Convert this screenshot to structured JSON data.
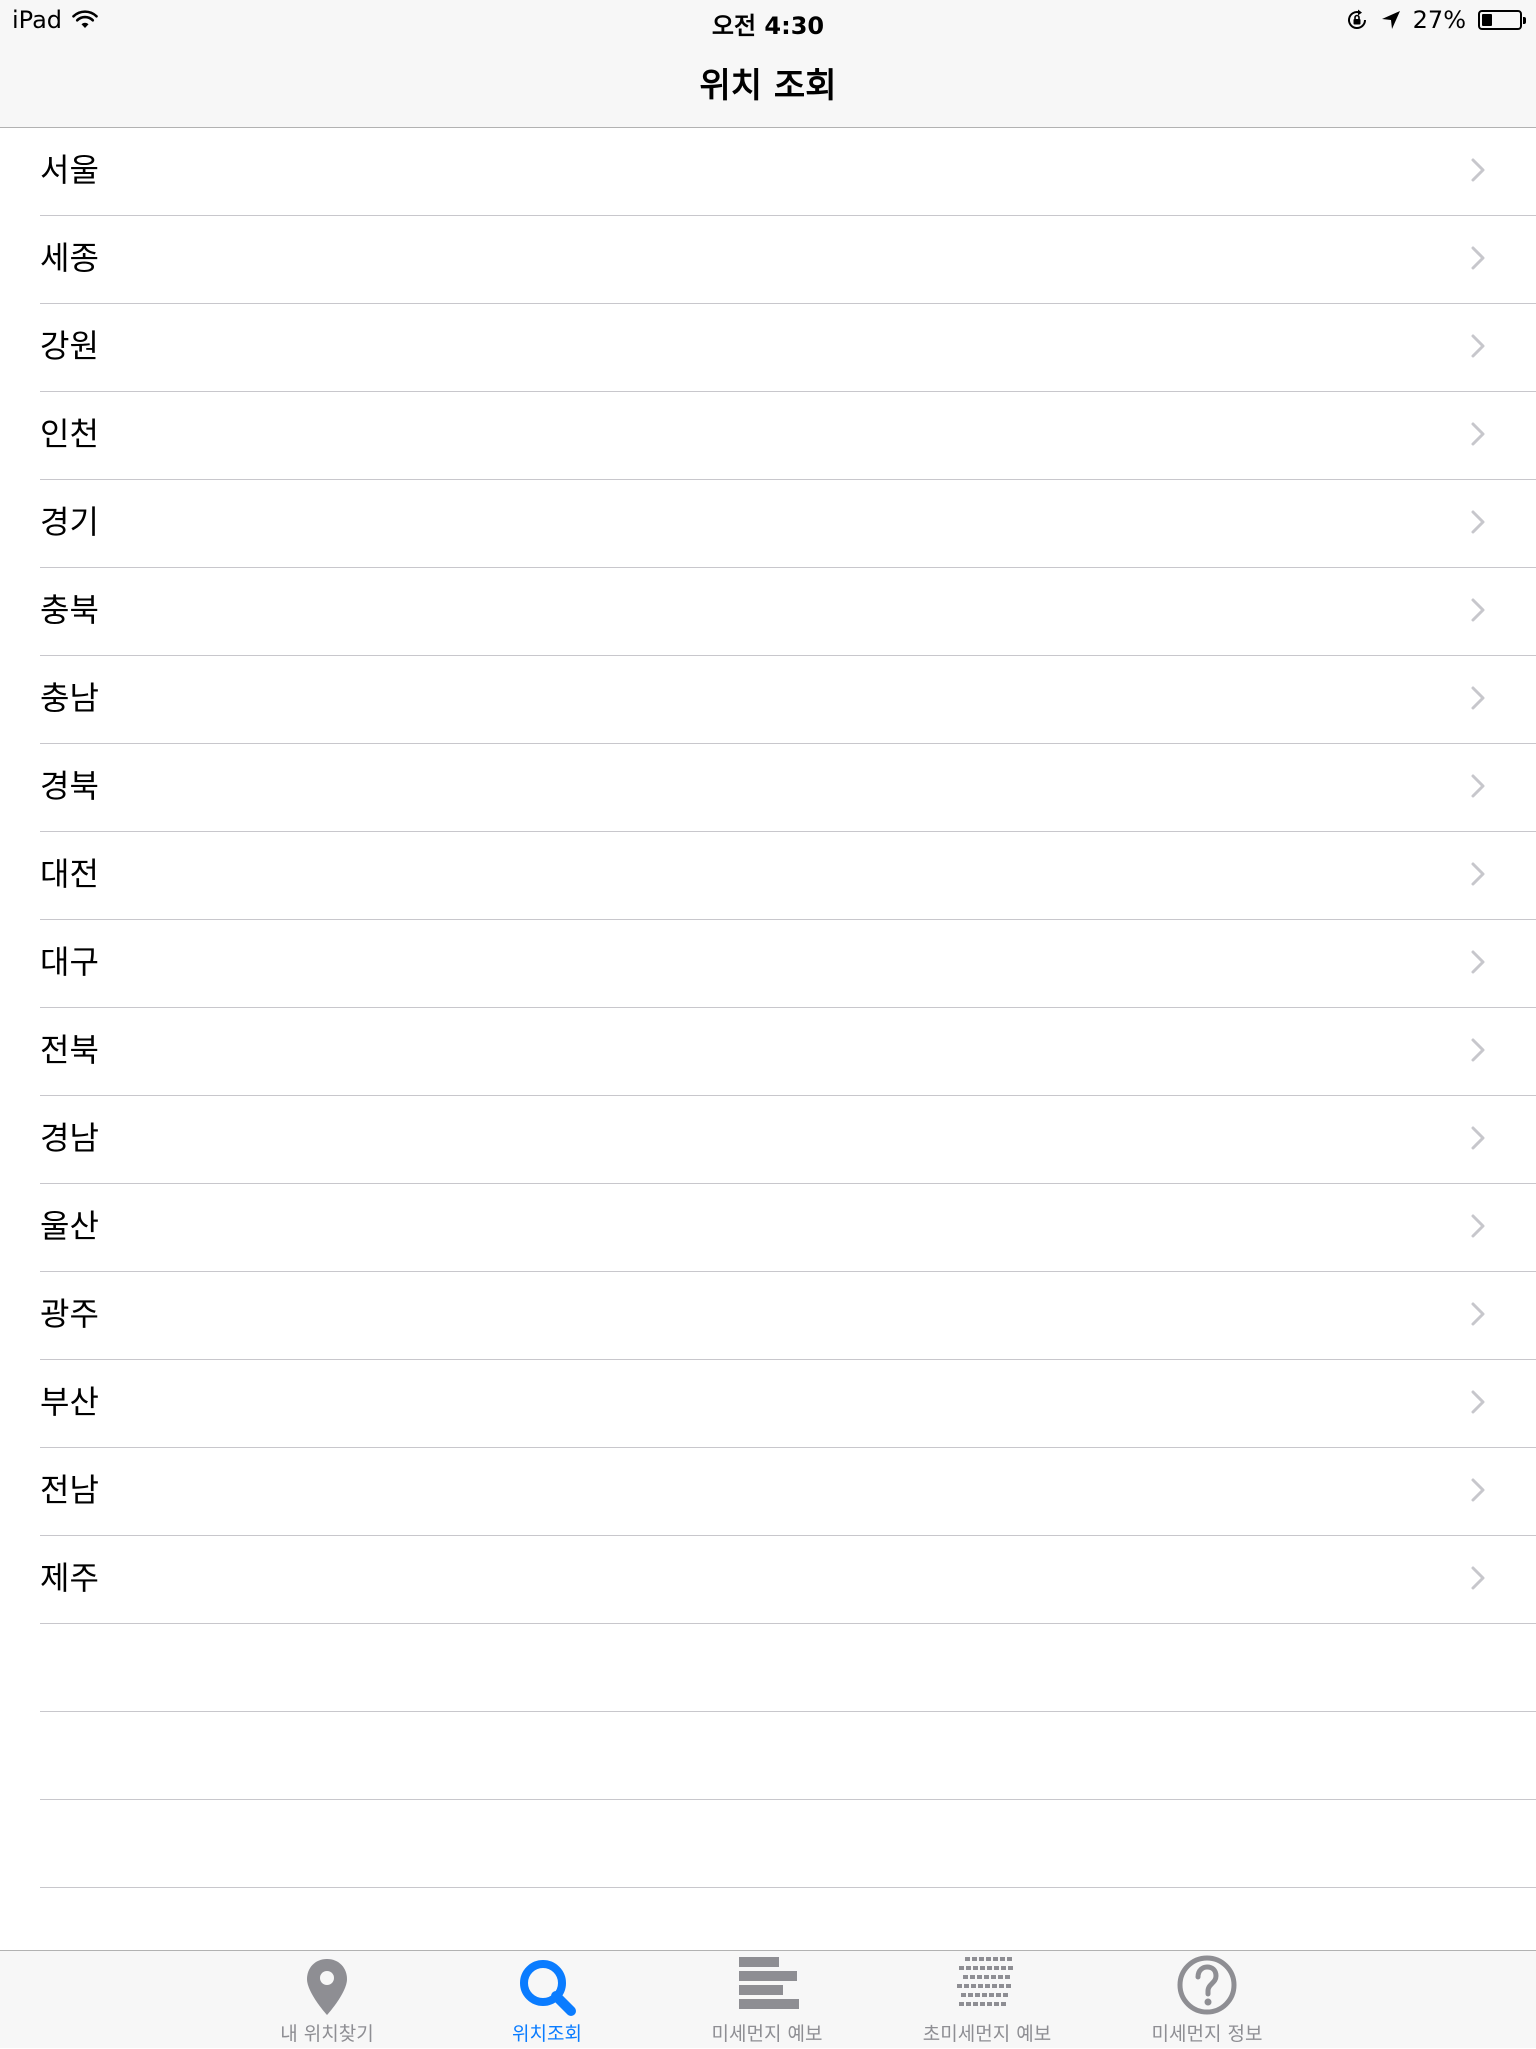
{
  "status_bar": {
    "device": "iPad",
    "time": "오전 4:30",
    "battery_percent": "27%",
    "battery_level": 0.27,
    "icons": [
      "wifi-icon",
      "rotation-lock-icon",
      "location-arrow-icon",
      "battery-icon"
    ]
  },
  "nav": {
    "title": "위치 조회"
  },
  "regions": [
    "서울",
    "세종",
    "강원",
    "인천",
    "경기",
    "충북",
    "충남",
    "경북",
    "대전",
    "대구",
    "전북",
    "경남",
    "울산",
    "광주",
    "부산",
    "전남",
    "제주"
  ],
  "tabs": [
    {
      "label": "내 위치찾기",
      "icon": "location-pin-icon",
      "active": false
    },
    {
      "label": "위치조회",
      "icon": "search-icon",
      "active": true
    },
    {
      "label": "미세먼지 예보",
      "icon": "bars-icon",
      "active": false
    },
    {
      "label": "초미세먼지 예보",
      "icon": "dotted-bars-icon",
      "active": false
    },
    {
      "label": "미세먼지 정보",
      "icon": "question-icon",
      "active": false
    }
  ],
  "colors": {
    "accent": "#0a7cff",
    "inactive": "#8e8e93",
    "separator": "#c8c7cc",
    "bar_background": "#f7f7f7"
  }
}
